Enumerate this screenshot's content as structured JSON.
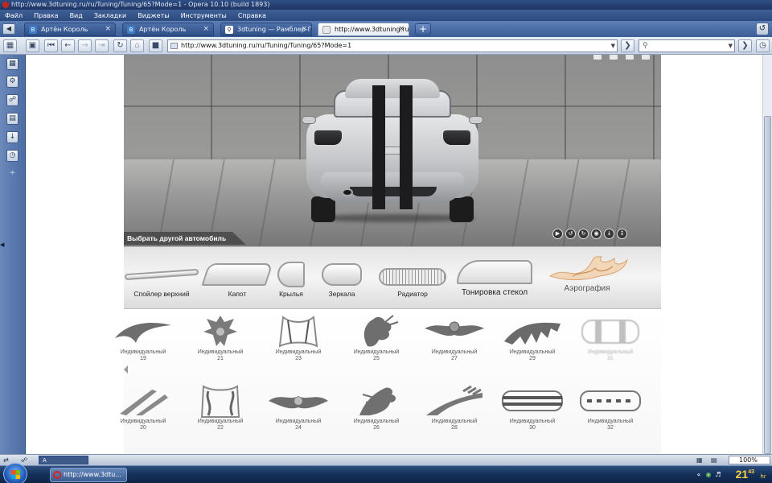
{
  "window": {
    "title": "http://www.3dtuning.ru/ru/Tuning/Tuning/65?Mode=1 - Opera 10.10 (build 1893)"
  },
  "menu": [
    "Файл",
    "Правка",
    "Вид",
    "Закладки",
    "Виджеты",
    "Инструменты",
    "Справка"
  ],
  "tabs": [
    {
      "label": "Артён Король",
      "icon": "В",
      "active": false
    },
    {
      "label": "Артён Король",
      "icon": "В",
      "active": false
    },
    {
      "label": "3dtuning — Рамблер-По...",
      "icon": "search-icon",
      "active": false
    },
    {
      "label": "http://www.3dtuning.ru...",
      "icon": "page-icon",
      "active": true
    }
  ],
  "new_tab_label": "+",
  "address": {
    "url": "http://www.3dtuning.ru/ru/Tuning/Tuning/65?Mode=1",
    "search_placeholder": ""
  },
  "showroom": {
    "choose_car_label": "Выбрать другой автомобиль"
  },
  "categories": [
    {
      "label": "Спойлер верхний",
      "active": false
    },
    {
      "label": "Капот",
      "active": false
    },
    {
      "label": "Крылья",
      "active": false
    },
    {
      "label": "Зеркала",
      "active": false
    },
    {
      "label": "Радиатор",
      "active": false
    },
    {
      "label": "Тонировка стекол",
      "active": false
    },
    {
      "label": "Аэрография",
      "active": true
    }
  ],
  "decals_row1": [
    {
      "name": "Индивидуальный",
      "number": "19"
    },
    {
      "name": "Индивидуальный",
      "number": "21"
    },
    {
      "name": "Индивидуальный",
      "number": "23"
    },
    {
      "name": "Индивидуальный",
      "number": "25"
    },
    {
      "name": "Индивидуальный",
      "number": "27"
    },
    {
      "name": "Индивидуальный",
      "number": "29"
    },
    {
      "name": "Индивидуальный",
      "number": "31"
    }
  ],
  "decals_row2": [
    {
      "name": "Индивидуальный",
      "number": "20"
    },
    {
      "name": "Индивидуальный",
      "number": "22"
    },
    {
      "name": "Индивидуальный",
      "number": "24"
    },
    {
      "name": "Индивидуальный",
      "number": "26"
    },
    {
      "name": "Индивидуальный",
      "number": "28"
    },
    {
      "name": "Индивидуальный",
      "number": "30"
    },
    {
      "name": "Индивидуальный",
      "number": "32"
    }
  ],
  "statusbar": {
    "input_value": "A",
    "zoom": "100%"
  },
  "taskbar": {
    "task_label": "http://www.3dtu...",
    "clock_hours": "21",
    "clock_minutes": "43",
    "clock_suffix": "hr"
  },
  "colors": {
    "accent": "#2f4f86",
    "clock": "#ffd23b"
  }
}
